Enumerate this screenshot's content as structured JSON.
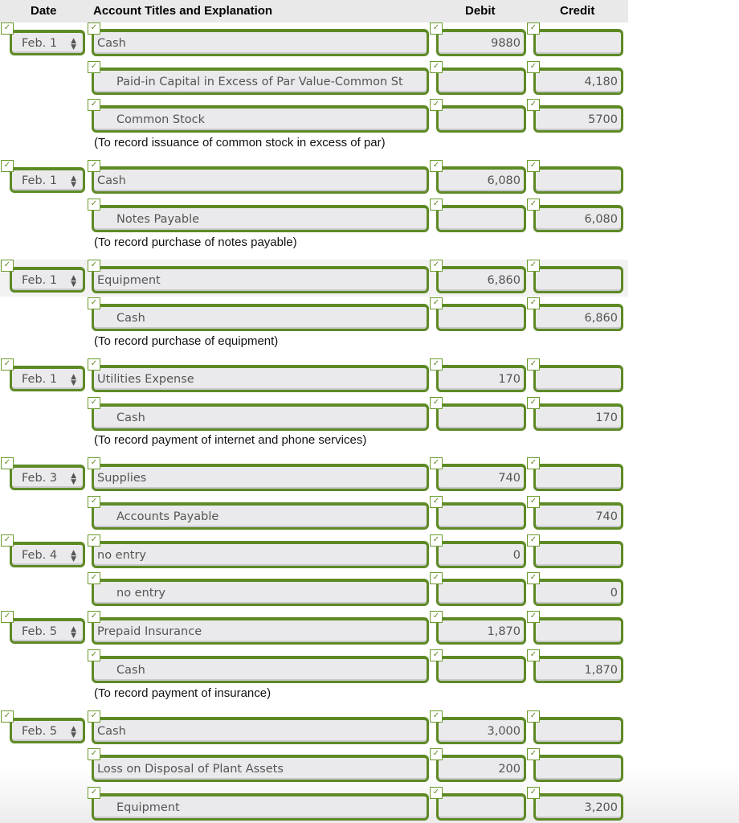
{
  "header": {
    "date": "Date",
    "account": "Account Titles and Explanation",
    "debit": "Debit",
    "credit": "Credit"
  },
  "icons": {
    "check": "✓",
    "stepper": "▲▼"
  },
  "colors": {
    "field_border": "#5e8a25",
    "field_bg": "#eaeaec",
    "header_bg": "#e9e9e9"
  },
  "entries": [
    {
      "date": "Feb. 1",
      "lines": [
        {
          "account": "Cash",
          "debit": "9880",
          "credit": "",
          "indent": false
        },
        {
          "account": "Paid-in Capital in Excess of Par Value-Common St",
          "debit": "",
          "credit": "4,180",
          "indent": true
        },
        {
          "account": "Common Stock",
          "debit": "",
          "credit": "5700",
          "indent": true
        }
      ],
      "memo": "(To record issuance of common stock in excess of par)"
    },
    {
      "date": "Feb. 1",
      "lines": [
        {
          "account": "Cash",
          "debit": "6,080",
          "credit": "",
          "indent": false
        },
        {
          "account": "Notes Payable",
          "debit": "",
          "credit": "6,080",
          "indent": true
        }
      ],
      "memo": "(To record purchase of notes payable)"
    },
    {
      "date": "Feb. 1",
      "highlight": true,
      "lines": [
        {
          "account": "Equipment",
          "debit": "6,860",
          "credit": "",
          "indent": false
        },
        {
          "account": "Cash",
          "debit": "",
          "credit": "6,860",
          "indent": true
        }
      ],
      "memo": "(To record purchase of equipment)"
    },
    {
      "date": "Feb. 1",
      "lines": [
        {
          "account": "Utilities Expense",
          "debit": "170",
          "credit": "",
          "indent": false
        },
        {
          "account": "Cash",
          "debit": "",
          "credit": "170",
          "indent": true
        }
      ],
      "memo": "(To record payment of internet and phone services)"
    },
    {
      "date": "Feb. 3",
      "lines": [
        {
          "account": "Supplies",
          "debit": "740",
          "credit": "",
          "indent": false
        },
        {
          "account": "Accounts Payable",
          "debit": "",
          "credit": "740",
          "indent": true
        }
      ],
      "memo": ""
    },
    {
      "date": "Feb. 4",
      "lines": [
        {
          "account": "no entry",
          "debit": "0",
          "credit": "",
          "indent": false
        },
        {
          "account": "no entry",
          "debit": "",
          "credit": "0",
          "indent": true
        }
      ],
      "memo": ""
    },
    {
      "date": "Feb. 5",
      "lines": [
        {
          "account": "Prepaid Insurance",
          "debit": "1,870",
          "credit": "",
          "indent": false
        },
        {
          "account": "Cash",
          "debit": "",
          "credit": "1,870",
          "indent": true
        }
      ],
      "memo": "(To record payment of insurance)"
    },
    {
      "date": "Feb. 5",
      "lines": [
        {
          "account": "Cash",
          "debit": "3,000",
          "credit": "",
          "indent": false
        },
        {
          "account": "Loss on Disposal of Plant Assets",
          "debit": "200",
          "credit": "",
          "indent": false
        },
        {
          "account": "Equipment",
          "debit": "",
          "credit": "3,200",
          "indent": true
        }
      ],
      "memo": ""
    }
  ]
}
